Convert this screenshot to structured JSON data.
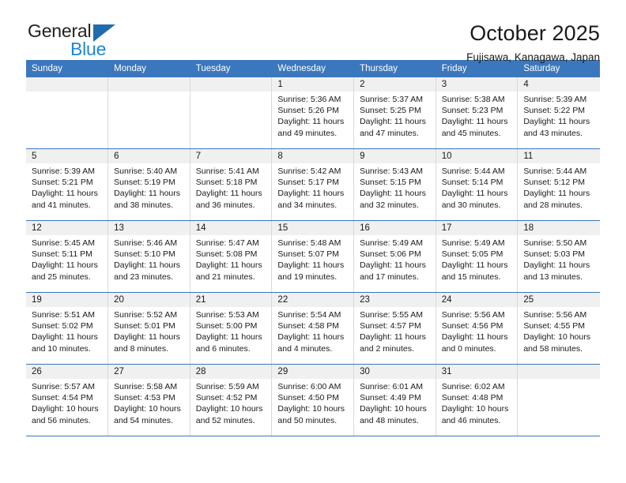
{
  "brand": {
    "name_top": "General",
    "name_bottom": "Blue",
    "triangle_color": "#1f6cb0",
    "blue_text_color": "#1b87d4"
  },
  "header": {
    "title": "October 2025",
    "subtitle": "Fujisawa, Kanagawa, Japan",
    "header_bg_color": "#3b77bc",
    "daynum_bg_color": "#f0f0f0"
  },
  "weekdays": [
    "Sunday",
    "Monday",
    "Tuesday",
    "Wednesday",
    "Thursday",
    "Friday",
    "Saturday"
  ],
  "weeks": [
    [
      {
        "day": "",
        "empty": true
      },
      {
        "day": "",
        "empty": true
      },
      {
        "day": "",
        "empty": true
      },
      {
        "day": "1",
        "sunrise": "Sunrise: 5:36 AM",
        "sunset": "Sunset: 5:26 PM",
        "daylight1": "Daylight: 11 hours",
        "daylight2": "and 49 minutes."
      },
      {
        "day": "2",
        "sunrise": "Sunrise: 5:37 AM",
        "sunset": "Sunset: 5:25 PM",
        "daylight1": "Daylight: 11 hours",
        "daylight2": "and 47 minutes."
      },
      {
        "day": "3",
        "sunrise": "Sunrise: 5:38 AM",
        "sunset": "Sunset: 5:23 PM",
        "daylight1": "Daylight: 11 hours",
        "daylight2": "and 45 minutes."
      },
      {
        "day": "4",
        "sunrise": "Sunrise: 5:39 AM",
        "sunset": "Sunset: 5:22 PM",
        "daylight1": "Daylight: 11 hours",
        "daylight2": "and 43 minutes."
      }
    ],
    [
      {
        "day": "5",
        "sunrise": "Sunrise: 5:39 AM",
        "sunset": "Sunset: 5:21 PM",
        "daylight1": "Daylight: 11 hours",
        "daylight2": "and 41 minutes."
      },
      {
        "day": "6",
        "sunrise": "Sunrise: 5:40 AM",
        "sunset": "Sunset: 5:19 PM",
        "daylight1": "Daylight: 11 hours",
        "daylight2": "and 38 minutes."
      },
      {
        "day": "7",
        "sunrise": "Sunrise: 5:41 AM",
        "sunset": "Sunset: 5:18 PM",
        "daylight1": "Daylight: 11 hours",
        "daylight2": "and 36 minutes."
      },
      {
        "day": "8",
        "sunrise": "Sunrise: 5:42 AM",
        "sunset": "Sunset: 5:17 PM",
        "daylight1": "Daylight: 11 hours",
        "daylight2": "and 34 minutes."
      },
      {
        "day": "9",
        "sunrise": "Sunrise: 5:43 AM",
        "sunset": "Sunset: 5:15 PM",
        "daylight1": "Daylight: 11 hours",
        "daylight2": "and 32 minutes."
      },
      {
        "day": "10",
        "sunrise": "Sunrise: 5:44 AM",
        "sunset": "Sunset: 5:14 PM",
        "daylight1": "Daylight: 11 hours",
        "daylight2": "and 30 minutes."
      },
      {
        "day": "11",
        "sunrise": "Sunrise: 5:44 AM",
        "sunset": "Sunset: 5:12 PM",
        "daylight1": "Daylight: 11 hours",
        "daylight2": "and 28 minutes."
      }
    ],
    [
      {
        "day": "12",
        "sunrise": "Sunrise: 5:45 AM",
        "sunset": "Sunset: 5:11 PM",
        "daylight1": "Daylight: 11 hours",
        "daylight2": "and 25 minutes."
      },
      {
        "day": "13",
        "sunrise": "Sunrise: 5:46 AM",
        "sunset": "Sunset: 5:10 PM",
        "daylight1": "Daylight: 11 hours",
        "daylight2": "and 23 minutes."
      },
      {
        "day": "14",
        "sunrise": "Sunrise: 5:47 AM",
        "sunset": "Sunset: 5:08 PM",
        "daylight1": "Daylight: 11 hours",
        "daylight2": "and 21 minutes."
      },
      {
        "day": "15",
        "sunrise": "Sunrise: 5:48 AM",
        "sunset": "Sunset: 5:07 PM",
        "daylight1": "Daylight: 11 hours",
        "daylight2": "and 19 minutes."
      },
      {
        "day": "16",
        "sunrise": "Sunrise: 5:49 AM",
        "sunset": "Sunset: 5:06 PM",
        "daylight1": "Daylight: 11 hours",
        "daylight2": "and 17 minutes."
      },
      {
        "day": "17",
        "sunrise": "Sunrise: 5:49 AM",
        "sunset": "Sunset: 5:05 PM",
        "daylight1": "Daylight: 11 hours",
        "daylight2": "and 15 minutes."
      },
      {
        "day": "18",
        "sunrise": "Sunrise: 5:50 AM",
        "sunset": "Sunset: 5:03 PM",
        "daylight1": "Daylight: 11 hours",
        "daylight2": "and 13 minutes."
      }
    ],
    [
      {
        "day": "19",
        "sunrise": "Sunrise: 5:51 AM",
        "sunset": "Sunset: 5:02 PM",
        "daylight1": "Daylight: 11 hours",
        "daylight2": "and 10 minutes."
      },
      {
        "day": "20",
        "sunrise": "Sunrise: 5:52 AM",
        "sunset": "Sunset: 5:01 PM",
        "daylight1": "Daylight: 11 hours",
        "daylight2": "and 8 minutes."
      },
      {
        "day": "21",
        "sunrise": "Sunrise: 5:53 AM",
        "sunset": "Sunset: 5:00 PM",
        "daylight1": "Daylight: 11 hours",
        "daylight2": "and 6 minutes."
      },
      {
        "day": "22",
        "sunrise": "Sunrise: 5:54 AM",
        "sunset": "Sunset: 4:58 PM",
        "daylight1": "Daylight: 11 hours",
        "daylight2": "and 4 minutes."
      },
      {
        "day": "23",
        "sunrise": "Sunrise: 5:55 AM",
        "sunset": "Sunset: 4:57 PM",
        "daylight1": "Daylight: 11 hours",
        "daylight2": "and 2 minutes."
      },
      {
        "day": "24",
        "sunrise": "Sunrise: 5:56 AM",
        "sunset": "Sunset: 4:56 PM",
        "daylight1": "Daylight: 11 hours",
        "daylight2": "and 0 minutes."
      },
      {
        "day": "25",
        "sunrise": "Sunrise: 5:56 AM",
        "sunset": "Sunset: 4:55 PM",
        "daylight1": "Daylight: 10 hours",
        "daylight2": "and 58 minutes."
      }
    ],
    [
      {
        "day": "26",
        "sunrise": "Sunrise: 5:57 AM",
        "sunset": "Sunset: 4:54 PM",
        "daylight1": "Daylight: 10 hours",
        "daylight2": "and 56 minutes."
      },
      {
        "day": "27",
        "sunrise": "Sunrise: 5:58 AM",
        "sunset": "Sunset: 4:53 PM",
        "daylight1": "Daylight: 10 hours",
        "daylight2": "and 54 minutes."
      },
      {
        "day": "28",
        "sunrise": "Sunrise: 5:59 AM",
        "sunset": "Sunset: 4:52 PM",
        "daylight1": "Daylight: 10 hours",
        "daylight2": "and 52 minutes."
      },
      {
        "day": "29",
        "sunrise": "Sunrise: 6:00 AM",
        "sunset": "Sunset: 4:50 PM",
        "daylight1": "Daylight: 10 hours",
        "daylight2": "and 50 minutes."
      },
      {
        "day": "30",
        "sunrise": "Sunrise: 6:01 AM",
        "sunset": "Sunset: 4:49 PM",
        "daylight1": "Daylight: 10 hours",
        "daylight2": "and 48 minutes."
      },
      {
        "day": "31",
        "sunrise": "Sunrise: 6:02 AM",
        "sunset": "Sunset: 4:48 PM",
        "daylight1": "Daylight: 10 hours",
        "daylight2": "and 46 minutes."
      },
      {
        "day": "",
        "empty": true
      }
    ]
  ]
}
